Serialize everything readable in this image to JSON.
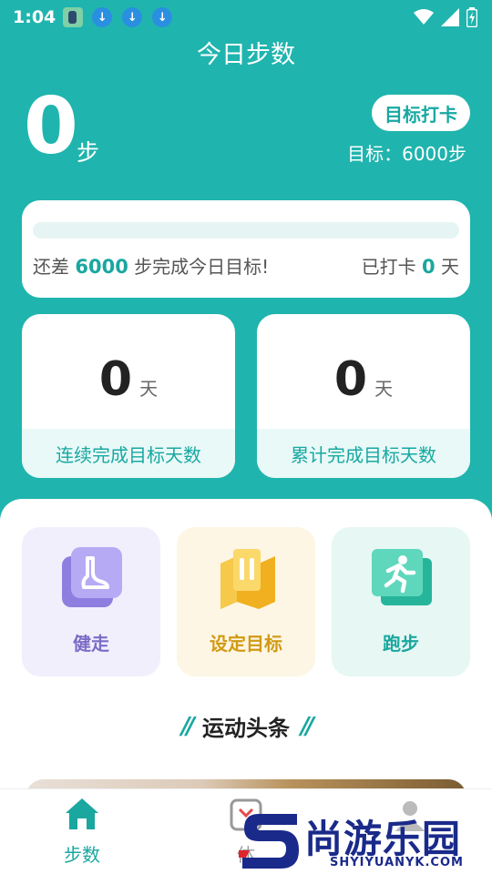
{
  "status_bar": {
    "time": "1:04"
  },
  "header": {
    "title": "今日步数"
  },
  "steps": {
    "count": "0",
    "unit": "步",
    "checkin_label": "目标打卡",
    "goal_text": "目标：6000步"
  },
  "progress": {
    "fraction": 0,
    "remaining_prefix": "还差",
    "remaining_value": "6000",
    "remaining_suffix": "步完成今日目标!",
    "checked_prefix": "已打卡",
    "checked_value": "0",
    "checked_suffix": "天"
  },
  "stats": [
    {
      "value": "0",
      "unit": "天",
      "label": "连续完成目标天数"
    },
    {
      "value": "0",
      "unit": "天",
      "label": "累计完成目标天数"
    }
  ],
  "features": [
    {
      "label": "健走",
      "icon": "walking-shoe-icon"
    },
    {
      "label": "设定目标",
      "icon": "goal-map-icon"
    },
    {
      "label": "跑步",
      "icon": "running-man-icon"
    }
  ],
  "news": {
    "title": "运动头条"
  },
  "bottom_nav": [
    {
      "label": "步数",
      "icon": "home-icon",
      "active": true
    },
    {
      "label": "体",
      "icon": "scale-icon",
      "active": false
    },
    {
      "label": "",
      "icon": "profile-icon",
      "active": false
    }
  ],
  "watermark": {
    "brand": "尚游乐园",
    "url": "SHYIYUANYK.COM"
  },
  "colors": {
    "primary": "#20b4ae",
    "accent_text": "#1aa7a0",
    "walk": "#7c6cc6",
    "goal": "#d09a14"
  }
}
